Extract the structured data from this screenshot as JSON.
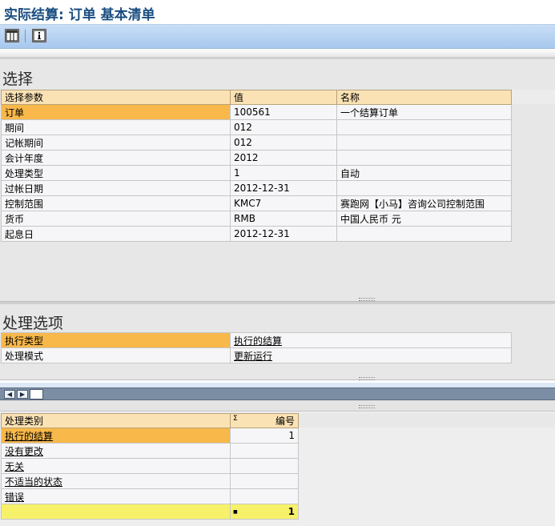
{
  "window": {
    "title": "实际结算: 订单 基本清单"
  },
  "toolbar": {
    "buttons": [
      {
        "icon": "layout-icon"
      },
      {
        "icon": "info-icon"
      }
    ]
  },
  "selection": {
    "title": "选择",
    "headers": [
      "选择参数",
      "值",
      "名称"
    ],
    "rows": [
      {
        "param": "订单",
        "value": "100561",
        "name": "一个结算订单"
      },
      {
        "param": "期间",
        "value": "012",
        "name": ""
      },
      {
        "param": "记帐期间",
        "value": "012",
        "name": ""
      },
      {
        "param": "会计年度",
        "value": "2012",
        "name": ""
      },
      {
        "param": "处理类型",
        "value": "1",
        "name": "自动"
      },
      {
        "param": "过帐日期",
        "value": "2012-12-31",
        "name": ""
      },
      {
        "param": "控制范围",
        "value": "KMC7",
        "name": "赛跑网【小马】咨询公司控制范围"
      },
      {
        "param": "货币",
        "value": "RMB",
        "name": "中国人民币 元"
      },
      {
        "param": "起息日",
        "value": "2012-12-31",
        "name": ""
      }
    ]
  },
  "options": {
    "title": "处理选项",
    "rows": [
      {
        "label": "执行类型",
        "value": "执行的结算"
      },
      {
        "label": "处理模式",
        "value": "更新运行"
      }
    ]
  },
  "category_table": {
    "headers": {
      "category": "处理类别",
      "sigma": "Σ",
      "count": "编号"
    },
    "rows": [
      {
        "category": "执行的结算",
        "count": "1"
      },
      {
        "category": "没有更改",
        "count": ""
      },
      {
        "category": "无关",
        "count": ""
      },
      {
        "category": "不适当的状态",
        "count": ""
      },
      {
        "category": "错误",
        "count": ""
      }
    ],
    "total": {
      "marker": "■",
      "value": "1"
    }
  },
  "colors": {
    "key_highlight": "#f8b84a",
    "header": "#fbe2b4",
    "total_row": "#f7f16a",
    "title": "#1a4d80"
  }
}
